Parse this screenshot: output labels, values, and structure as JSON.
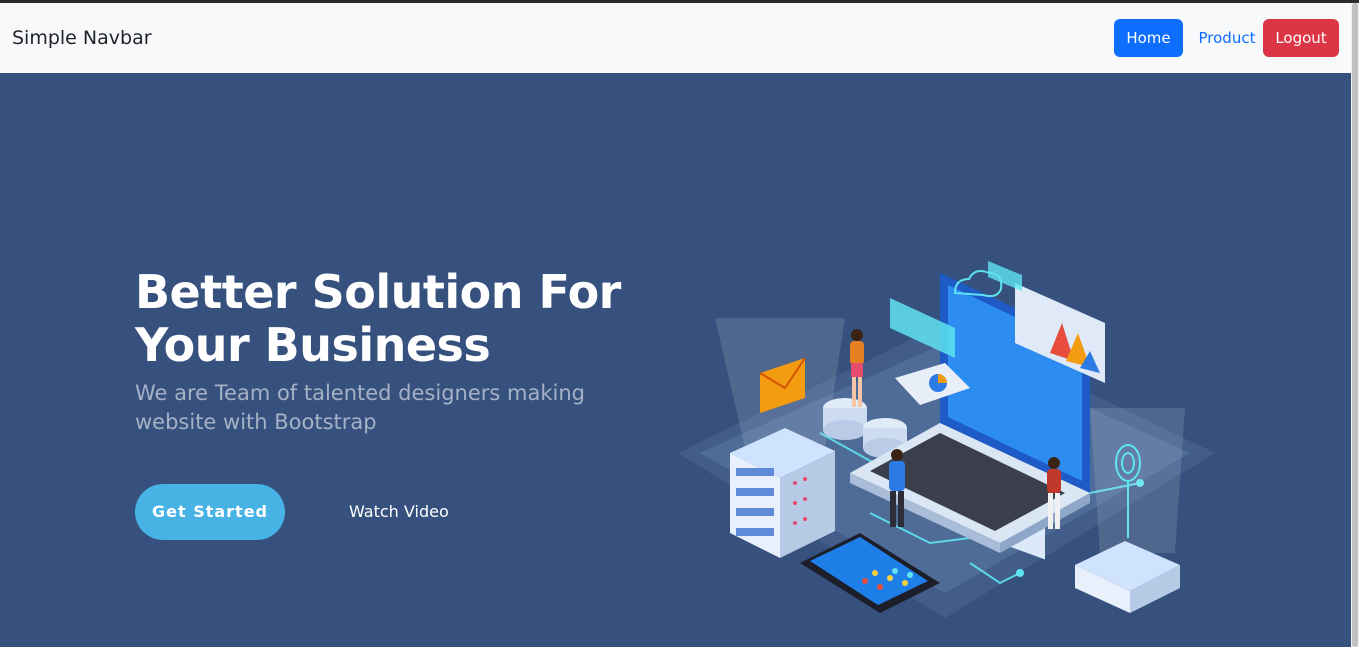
{
  "navbar": {
    "brand": "Simple Navbar",
    "home_label": "Home",
    "product_label": "Product",
    "logout_label": "Logout"
  },
  "hero": {
    "title_line1": "Better Solution For",
    "title_line2": "Your Business",
    "subtitle_line1": "We are Team of talented designers making",
    "subtitle_line2": "website with Bootstrap",
    "get_started_label": "Get Started",
    "watch_video_label": "Watch Video"
  },
  "colors": {
    "hero_bg": "#37517e",
    "accent": "#47b2e4",
    "primary": "#0d6efd",
    "danger": "#dc3545"
  }
}
